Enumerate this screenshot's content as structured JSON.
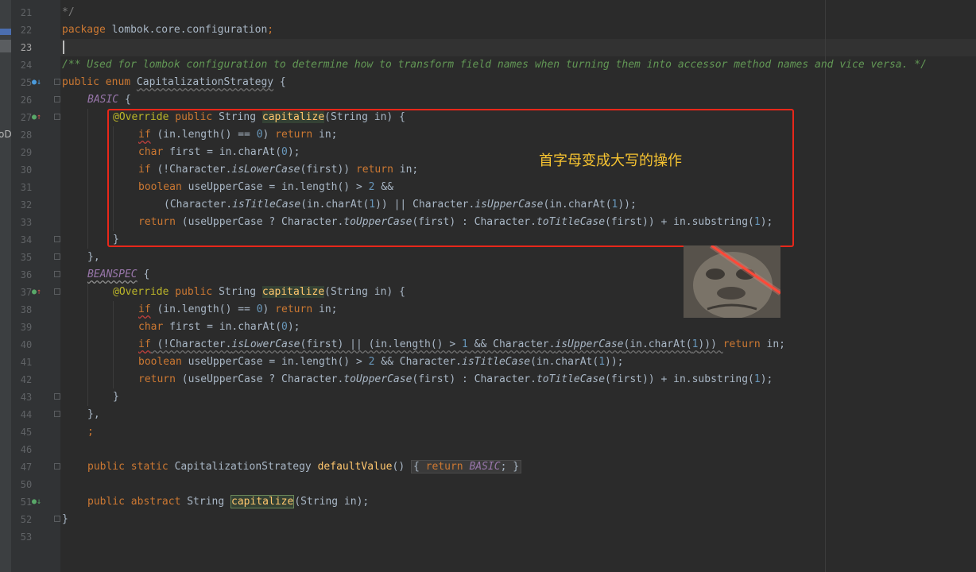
{
  "gutter": {
    "line_numbers": [
      "21",
      "22",
      "23",
      "24",
      "25",
      "26",
      "27",
      "28",
      "29",
      "30",
      "31",
      "32",
      "33",
      "34",
      "35",
      "36",
      "37",
      "38",
      "39",
      "40",
      "41",
      "42",
      "43",
      "44",
      "45",
      "46",
      "47",
      "50",
      "51",
      "52",
      "53"
    ],
    "current_line": "23"
  },
  "side_fragment": "oD",
  "code": {
    "l21": {
      "t": "*/"
    },
    "l22": {
      "kw": "package",
      "t": " lombok.core.configuration",
      "semi": ";"
    },
    "l24": {
      "comment": "/** Used for lombok configuration to determine how to transform field names when turning them into accessor method names and vice versa. */"
    },
    "l25": {
      "kw": "public enum",
      "name": "CapitalizationStrategy",
      "t": " {"
    },
    "l26": {
      "const": "BASIC",
      "t": " {"
    },
    "l27": {
      "ann": "@Override",
      "kw": "public",
      "t1": " String ",
      "fn": "capitalize",
      "t2": "(String in) {"
    },
    "l28": {
      "kw1": "if",
      "t1": " (in.length() == ",
      "n": "0",
      "t2": ") ",
      "kw2": "return",
      "t3": " in;"
    },
    "l29": {
      "kw": "char",
      "t1": " first = in.charAt(",
      "n": "0",
      "t2": ");"
    },
    "l30": {
      "kw1": "if",
      "t1": " (!Character.",
      "st": "isLowerCase",
      "t2": "(first)) ",
      "kw2": "return",
      "t3": " in;"
    },
    "l31": {
      "kw": "boolean",
      "t1": " useUpperCase = in.length() > ",
      "n": "2",
      "t2": " &&"
    },
    "l32": {
      "t1": "(Character.",
      "st1": "isTitleCase",
      "t2": "(in.charAt(",
      "n1": "1",
      "t3": ")) || Character.",
      "st2": "isUpperCase",
      "t4": "(in.charAt(",
      "n2": "1",
      "t5": "));"
    },
    "l33": {
      "kw": "return",
      "t1": " (useUpperCase ? Character.",
      "st1": "toUpperCase",
      "t2": "(first) : Character.",
      "st2": "toTitleCase",
      "t3": "(first)) + in.substring(",
      "n": "1",
      "t4": ");"
    },
    "l34": {
      "t": "}"
    },
    "l35": {
      "t": "},"
    },
    "l36": {
      "const": "BEANSPEC",
      "t": " {"
    },
    "l37": {
      "ann": "@Override",
      "kw": "public",
      "t1": " String ",
      "fn": "capitalize",
      "t2": "(String in) {"
    },
    "l38": {
      "kw1": "if",
      "t1": " (in.length() == ",
      "n": "0",
      "t2": ") ",
      "kw2": "return",
      "t3": " in;"
    },
    "l39": {
      "kw": "char",
      "t1": " first = in.charAt(",
      "n": "0",
      "t2": ");"
    },
    "l40": {
      "kw1": "if",
      "t1": " (!Character.",
      "st1": "isLowerCase",
      "t2": "(first) || (in.length() > ",
      "n1": "1",
      "t3": " && Character.",
      "st2": "isUpperCase",
      "t4": "(in.charAt(",
      "n2": "1",
      "t5": "))) ",
      "kw2": "return",
      "t6": " in;"
    },
    "l41": {
      "kw": "boolean",
      "t1": " useUpperCase = in.length() > ",
      "n1": "2",
      "t2": " && Character.",
      "st": "isTitleCase",
      "t3": "(in.charAt(",
      "n2": "1",
      "t4": "));"
    },
    "l42": {
      "kw": "return",
      "t1": " (useUpperCase ? Character.",
      "st1": "toUpperCase",
      "t2": "(first) : Character.",
      "st2": "toTitleCase",
      "t3": "(first)) + in.substring(",
      "n": "1",
      "t4": ");"
    },
    "l43": {
      "t": "}"
    },
    "l44": {
      "t": "},"
    },
    "l45": {
      "t": ";"
    },
    "l47": {
      "kw": "public static",
      "t1": " CapitalizationStrategy ",
      "fn": "defaultValue",
      "t2": "() ",
      "t3": "{ ",
      "kw2": "return",
      "const": "BASIC",
      "t4": "; }"
    },
    "l51": {
      "kw": "public abstract",
      "t1": " String ",
      "fn": "capitalize",
      "t2": "(String in);"
    },
    "l52": {
      "t": "}"
    }
  },
  "annotation_note": "首字母变成大写的操作",
  "colors": {
    "background": "#2b2b2b",
    "keyword": "#cc7832",
    "comment": "#629755",
    "annotation": "#bbb529",
    "method": "#ffc66d",
    "number": "#6897bb",
    "enum_constant": "#9876aa",
    "highlight_box": "#e8271a",
    "note_text": "#f7c431"
  }
}
